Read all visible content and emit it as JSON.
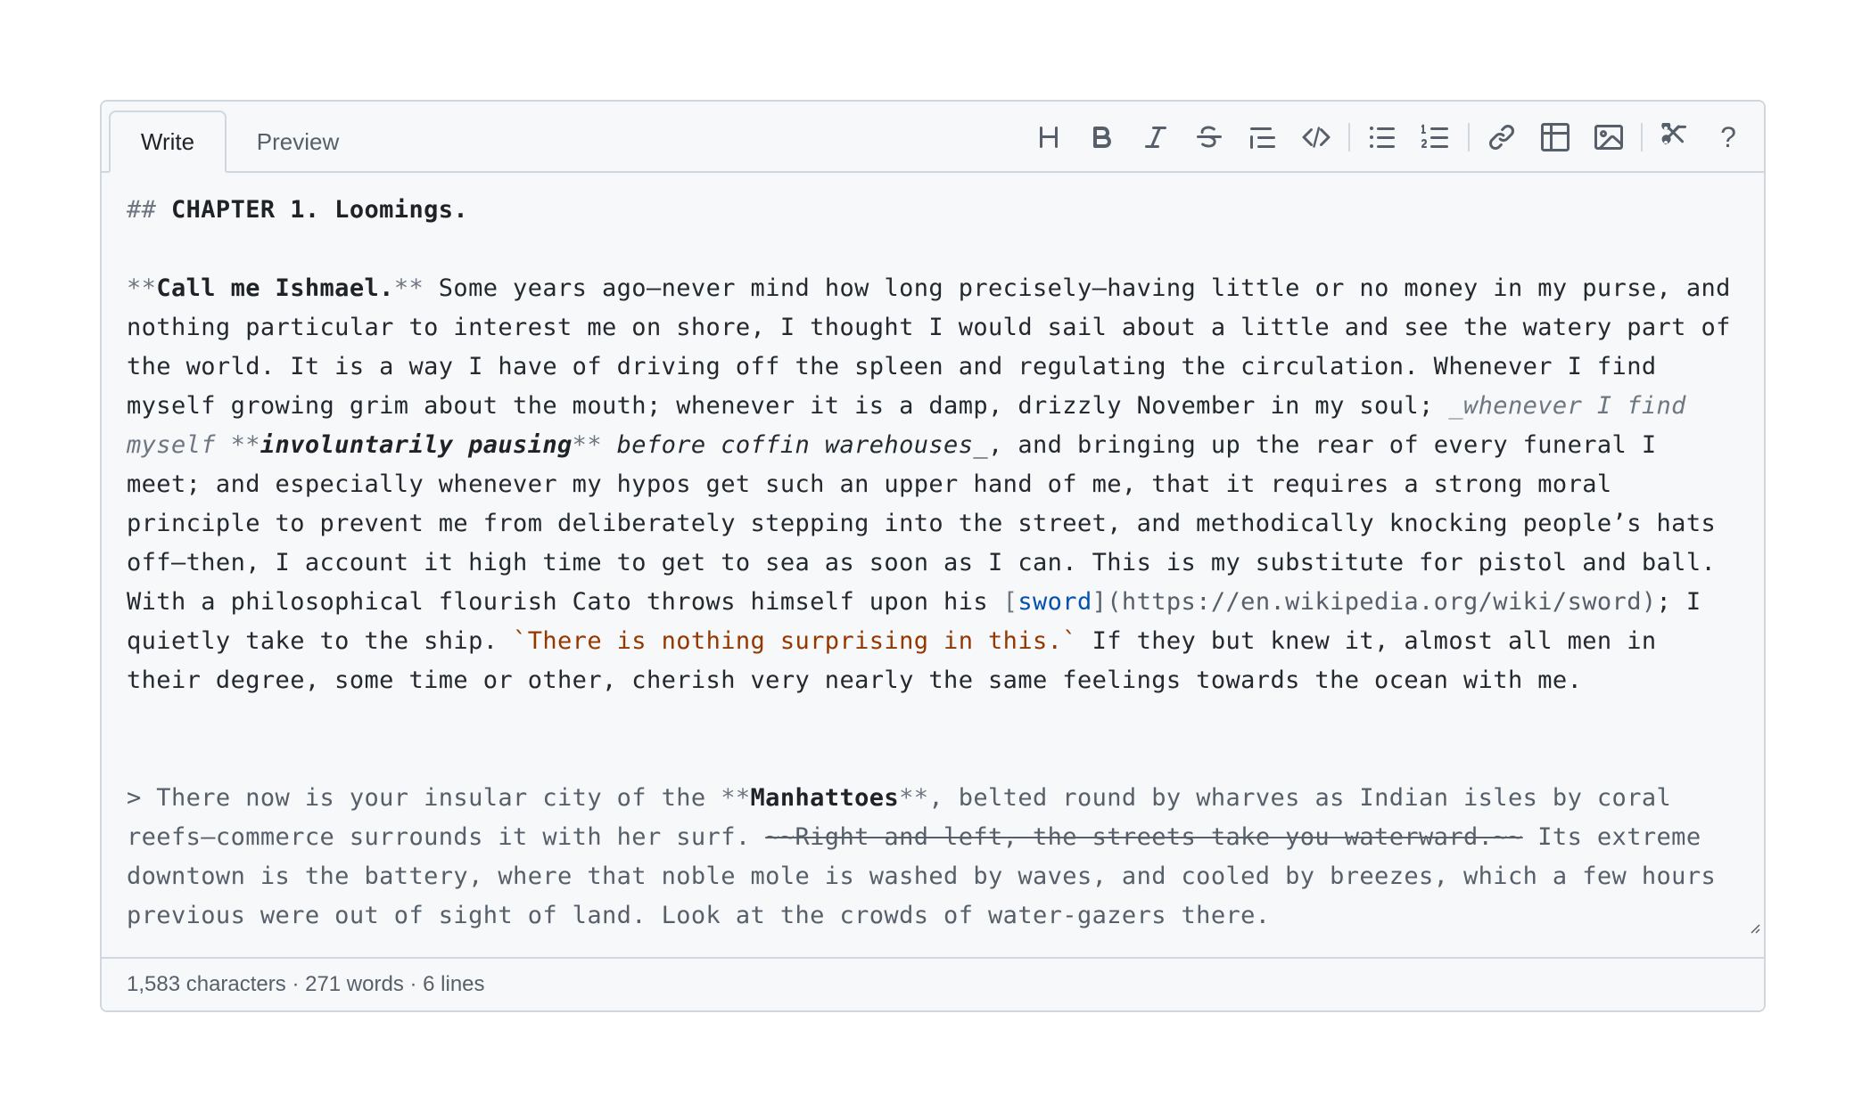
{
  "tabs": {
    "write": "Write",
    "preview": "Preview"
  },
  "toolbar": {
    "buttons": [
      "heading-icon",
      "bold-icon",
      "italic-icon",
      "strikethrough-icon",
      "quote-icon",
      "code-icon",
      "bullet-list-icon",
      "numbered-list-icon",
      "link-icon",
      "table-icon",
      "image-icon",
      "cut-icon",
      "help-icon"
    ],
    "help_label": "?"
  },
  "editor": {
    "heading_mark": "## ",
    "heading_text": "CHAPTER 1. Loomings.",
    "p1_mark_open": "**",
    "p1_bold": "Call me Ishmael.",
    "p1_mark_close": "**",
    "p1_a": " Some years ago—never mind how long precisely—having little or no money in my purse, and nothing particular to interest me on shore, I thought I would sail about a little and see the watery part of the world. It is a way I have of driving off the spleen and regulating the circulation. Whenever I find myself growing grim about the mouth; whenever it is a damp, drizzly November in my soul; ",
    "p1_em_open": "_whenever I find myself ",
    "p1_em_mark1": "**",
    "p1_em_bold": "involuntarily pausing",
    "p1_em_mark2": "**",
    "p1_em_close": " before coffin warehouses_",
    "p1_b": ", and bringing up the rear of every funeral I meet; and especially whenever my hypos get such an upper hand of me, that it requires a strong moral principle to prevent me from deliberately stepping into the street, and methodically knocking people’s hats off—then, I account it high time to get to sea as soon as I can. This is my substitute for pistol and ball. With a philosophical flourish Cato throws himself upon his ",
    "p1_link_open": "[",
    "p1_link_text": "sword",
    "p1_link_url": "](https://en.wikipedia.org/wiki/sword)",
    "p1_c": "; I quietly take to the ship. ",
    "p1_code": "`There is nothing surprising in this.`",
    "p1_d": " If they but knew it, almost all men in their degree, some time or other, cherish very nearly the same feelings towards the ocean with me.",
    "q_a": "> There now is your insular city of the ",
    "q_mark1": "**",
    "q_bold": "Manhattoes",
    "q_mark2": "**",
    "q_b": ", belted round by wharves as Indian isles by coral reefs—commerce surrounds it with her surf. ",
    "q_strike": "~~Right and left, the streets take you waterward.~~",
    "q_c": " Its extreme downtown is the battery, where that noble mole is washed by waves, and cooled by breezes, which a few hours previous were out of sight of land. Look at the crowds of water-gazers there."
  },
  "status": {
    "text": "1,583 characters · 271 words · 6 lines"
  }
}
